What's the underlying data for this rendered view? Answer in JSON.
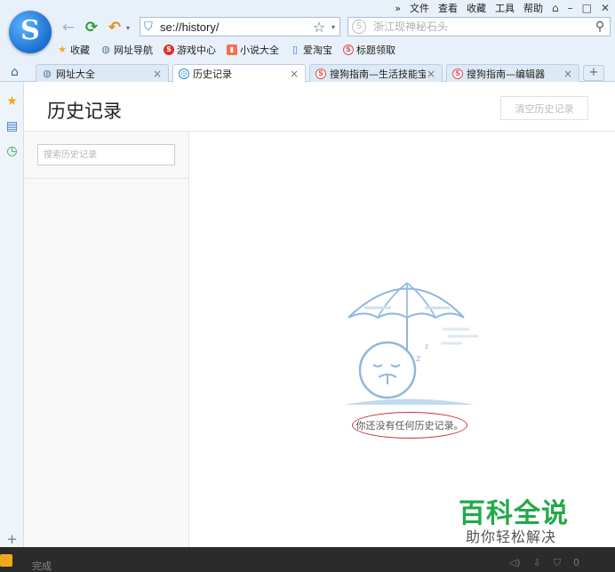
{
  "menubar": {
    "more": "»",
    "items": [
      "文件",
      "查看",
      "收藏",
      "工具",
      "帮助"
    ]
  },
  "address": {
    "url": "se://history/"
  },
  "search": {
    "placeholder": "浙江现神秘石头"
  },
  "bookmarks": [
    {
      "label": "收藏",
      "icon": "star-icon"
    },
    {
      "label": "网址导航",
      "icon": "globe-icon"
    },
    {
      "label": "游戏中心",
      "icon": "game-icon"
    },
    {
      "label": "小说大全",
      "icon": "book-icon"
    },
    {
      "label": "爱淘宝",
      "icon": "doc-icon"
    },
    {
      "label": "标题领取",
      "icon": "sogou-icon"
    }
  ],
  "tabs": [
    {
      "label": "网址大全",
      "icon": "globe-icon",
      "active": false
    },
    {
      "label": "历史记录",
      "icon": "history-icon",
      "active": true
    },
    {
      "label": "搜狗指南—生活技能宝",
      "icon": "sogou-icon",
      "active": false
    },
    {
      "label": "搜狗指南—编辑器",
      "icon": "sogou-icon",
      "active": false
    }
  ],
  "page": {
    "title": "历史记录",
    "clear_button": "清空历史记录",
    "search_placeholder": "搜索历史记录",
    "empty_message": "你还没有任何历史记录。"
  },
  "watermark": {
    "title": "百科全说",
    "subtitle": "助你轻松解决"
  },
  "status": {
    "text": "完成",
    "right_value": "0"
  },
  "colors": {
    "chrome_bg": "#e8f1f9",
    "accent_blue": "#2a8ad8",
    "highlight_red": "#c93434",
    "watermark_green": "#21a94a"
  }
}
